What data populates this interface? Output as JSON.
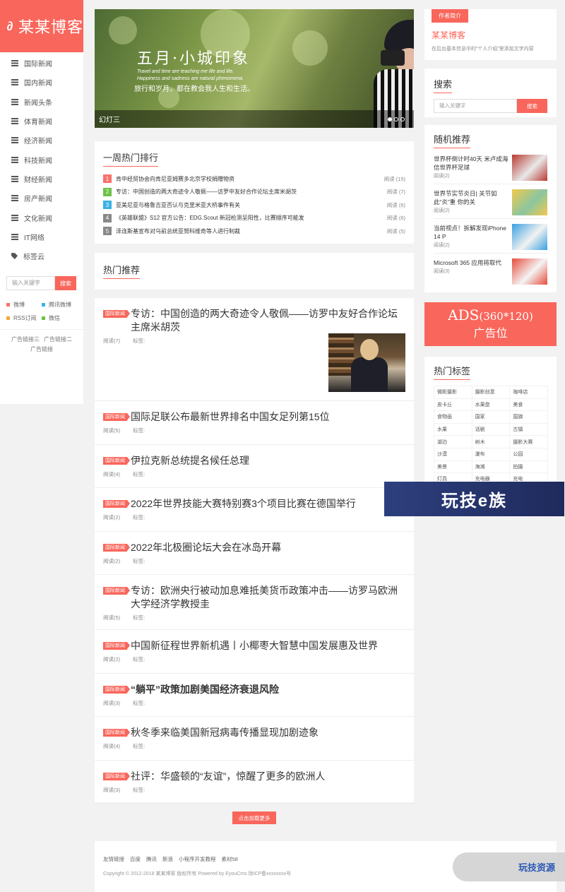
{
  "site": {
    "logo_mark": "∂",
    "name": "某某博客"
  },
  "nav": [
    {
      "label": "国际新闻",
      "icon": "list-icon"
    },
    {
      "label": "国内新闻",
      "icon": "list-icon"
    },
    {
      "label": "新闻头条",
      "icon": "list-icon"
    },
    {
      "label": "体育新闻",
      "icon": "list-icon"
    },
    {
      "label": "经济新闻",
      "icon": "list-icon"
    },
    {
      "label": "科技新闻",
      "icon": "list-icon"
    },
    {
      "label": "财经新闻",
      "icon": "list-icon"
    },
    {
      "label": "房产新闻",
      "icon": "list-icon"
    },
    {
      "label": "文化新闻",
      "icon": "list-icon"
    },
    {
      "label": "IT网络",
      "icon": "list-icon"
    },
    {
      "label": "标签云",
      "icon": "tag-icon"
    }
  ],
  "left_search": {
    "placeholder": "输入关键字",
    "button": "搜索"
  },
  "share": [
    {
      "label": "微博",
      "color": "#f7726a"
    },
    {
      "label": "腾讯微博",
      "color": "#3bb1e6"
    },
    {
      "label": "RSS订阅",
      "color": "#f3a83b"
    },
    {
      "label": "微信",
      "color": "#6cc24a"
    }
  ],
  "ad_links": [
    "广告链接三",
    "广告链接二",
    "广告链接"
  ],
  "slider": {
    "title": "五月·小城印象",
    "en1": "Travel and time are teaching me life and life.",
    "en2": "Happiness and sadness are natural phenomena.",
    "cn": "旅行和岁月，都在教会我人生和生活。",
    "caption": "幻灯三"
  },
  "hot_rank": {
    "title": "一周热门排行",
    "items": [
      {
        "num": "1",
        "color": "#f7726a",
        "title": "肯中经贸协会向肯尼亚姆赛多北京学校捐赠物资",
        "reads": "阅读 (15)"
      },
      {
        "num": "2",
        "color": "#6cc24a",
        "title": "专访：中国创造的两大奇迹令人敬佩——访罗中友好合作论坛主席米胡茨",
        "reads": "阅读 (7)"
      },
      {
        "num": "3",
        "color": "#3bb1e6",
        "title": "亚美尼亚与格鲁吉亚否认与克里米亚大桥事件有关",
        "reads": "阅读 (6)"
      },
      {
        "num": "4",
        "color": "#888888",
        "title": "《英雄联盟》S12 官方公告：EDG.Scout 新冠检测呈阳性，比赛顺序可能发",
        "reads": "阅读 (6)"
      },
      {
        "num": "5",
        "color": "#888888",
        "title": "泽连斯基宣布对乌前总统亚努科维奇等人进行制裁",
        "reads": "阅读 (5)"
      }
    ]
  },
  "recommend_title": "热门推荐",
  "articles": [
    {
      "badge": "国际新闻",
      "title": "专访：中国创造的两大奇迹令人敬佩——访罗中友好合作论坛主席米胡茨",
      "reads": "阅读(7)",
      "tags": "标签:",
      "image": true
    },
    {
      "badge": "国际新闻",
      "title": "国际足联公布最新世界排名中国女足列第15位",
      "reads": "阅读(5)",
      "tags": "标签:"
    },
    {
      "badge": "国际新闻",
      "title": "伊拉克新总统提名候任总理",
      "reads": "阅读(4)",
      "tags": "标签:"
    },
    {
      "badge": "国际新闻",
      "title": "2022年世界技能大赛特别赛3个项目比赛在德国举行",
      "reads": "阅读(2)",
      "tags": "标签:"
    },
    {
      "badge": "国际新闻",
      "title": "2022年北极圈论坛大会在冰岛开幕",
      "reads": "阅读(2)",
      "tags": "标签:"
    },
    {
      "badge": "国际新闻",
      "title": "专访：欧洲央行被动加息难抵美货币政策冲击——访罗马欧洲大学经济学教授圭",
      "reads": "阅读(5)",
      "tags": "标签:"
    },
    {
      "badge": "国际新闻",
      "title": "中国新征程世界新机遇丨小椰枣大智慧中国发展惠及世界",
      "reads": "阅读(2)",
      "tags": "标签:"
    },
    {
      "badge": "国际新闻",
      "title": "“躺平”政策加剧美国经济衰退风险",
      "reads": "阅读(3)",
      "tags": "标签:",
      "bold": true
    },
    {
      "badge": "国际新闻",
      "title": "秋冬季来临美国新冠病毒传播显现加剧迹象",
      "reads": "阅读(4)",
      "tags": "标签:"
    },
    {
      "badge": "国际新闻",
      "title": "社评：华盛顿的“友谊”，惊醒了更多的欧洲人",
      "reads": "阅读(3)",
      "tags": "标签:"
    }
  ],
  "load_more": "点击加载更多",
  "footer": {
    "links": [
      "友情链接",
      "百度",
      "腾讯",
      "新浪",
      "小程序开发教程",
      "素材58"
    ],
    "copyright": "Copyright © 2012-2018 某某博客 版权所有 Powered by EyouCms  琼ICP备xxxxxxxx号"
  },
  "about": {
    "label": "作者简介",
    "name": "某某博客",
    "desc": "在后台基本信息中的“个人介绍”里添加文字内容"
  },
  "right_search": {
    "title": "搜索",
    "placeholder": "输入关键字",
    "button": "搜索"
  },
  "random": {
    "title": "随机推荐",
    "items": [
      {
        "title": "世界杯倒计时40天 米卢成海信世界杯足球",
        "reads": "阅读(2)",
        "colors": [
          "#b93a32",
          "#e8e8e8"
        ]
      },
      {
        "title": "世界节实节炎日| 关节如此“炎”重 你的关",
        "reads": "阅读(2)",
        "colors": [
          "#f2c94c",
          "#8bc6a0"
        ]
      },
      {
        "title": "当前视点！拆解发现iPhone 14 P",
        "reads": "阅读(2)",
        "colors": [
          "#3aa0e0",
          "#f2f2f2"
        ]
      },
      {
        "title": "Microsoft 365 应用将取代",
        "reads": "阅读(3)",
        "colors": [
          "#e74c3c",
          "#f4f4f4"
        ]
      }
    ]
  },
  "ads": {
    "line1": "ADS",
    "size": "(360*120)",
    "line2": "广告位"
  },
  "tags": {
    "title": "热门标签",
    "items": [
      "微距摄影",
      "摄影创意",
      "咖啡店",
      "皮卡丘",
      "水果盘",
      "美食",
      "食物画",
      "国家",
      "国旗",
      "水果",
      "话剧",
      "古镇",
      "湖泊",
      "树木",
      "摄影大赛",
      "沙漠",
      "瀑布",
      "公园",
      "美景",
      "海滩",
      "拍摄",
      "灯具",
      "充电器",
      "充电"
    ]
  },
  "watermarks": {
    "ad": "玩技e族",
    "source": "玩技资源"
  }
}
